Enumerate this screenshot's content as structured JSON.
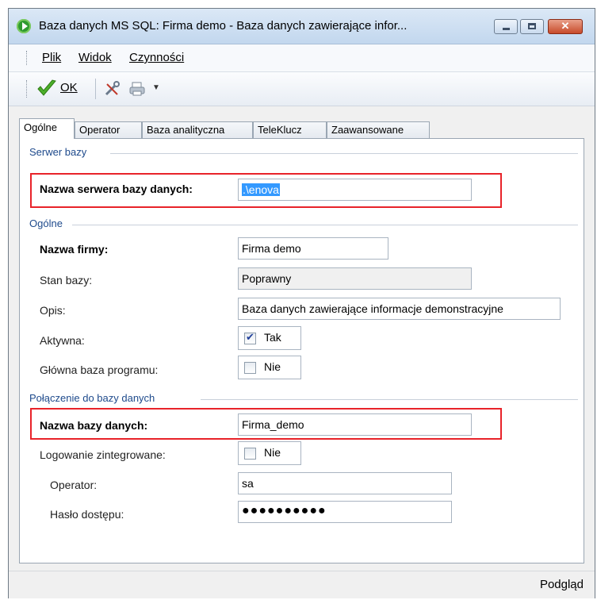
{
  "window": {
    "title": "Baza danych MS SQL: Firma demo - Baza danych zawierające infor...",
    "close_glyph": "✕"
  },
  "menu": {
    "items": [
      {
        "label": "Plik",
        "underline": "P"
      },
      {
        "label": "Widok",
        "underline": "W"
      },
      {
        "label": "Czynności",
        "underline": "C"
      }
    ]
  },
  "toolbar": {
    "ok_label": "OK",
    "icons": [
      "check-icon",
      "tools-icon",
      "printer-icon",
      "dropdown-arrow-icon"
    ]
  },
  "tabs": [
    {
      "label": "Ogólne",
      "active": true
    },
    {
      "label": "Operator",
      "active": false
    },
    {
      "label": "Baza analityczna",
      "active": false
    },
    {
      "label": "TeleKlucz",
      "active": false
    },
    {
      "label": "Zaawansowane",
      "active": false
    }
  ],
  "groups": {
    "server": "Serwer bazy",
    "general": "Ogólne",
    "connection": "Połączenie do bazy danych"
  },
  "fields": {
    "server_name_label": "Nazwa serwera bazy danych:",
    "server_name_value": ".\\enova",
    "company_name_label": "Nazwa firmy:",
    "company_name_value": "Firma demo",
    "db_state_label": "Stan bazy:",
    "db_state_value": "Poprawny",
    "description_label": "Opis:",
    "description_value": "Baza danych zawierające informacje demonstracyjne",
    "active_label": "Aktywna:",
    "active_value": "Tak",
    "main_db_label": "Główna baza programu:",
    "main_db_value": "Nie",
    "db_name_label": "Nazwa bazy danych:",
    "db_name_value": "Firma_demo",
    "integrated_login_label": "Logowanie zintegrowane:",
    "integrated_login_value": "Nie",
    "operator_label": "Operator:",
    "operator_value": "sa",
    "password_label": "Hasło dostępu:",
    "password_value": "●●●●●●●●●●"
  },
  "checks": {
    "active": true,
    "main_db": false,
    "integrated_login": false
  },
  "status": {
    "preview_label": "Podgląd"
  },
  "colors": {
    "highlight_box": "#e8232a",
    "selection": "#3399ff",
    "group_title": "#1e4a8c"
  }
}
